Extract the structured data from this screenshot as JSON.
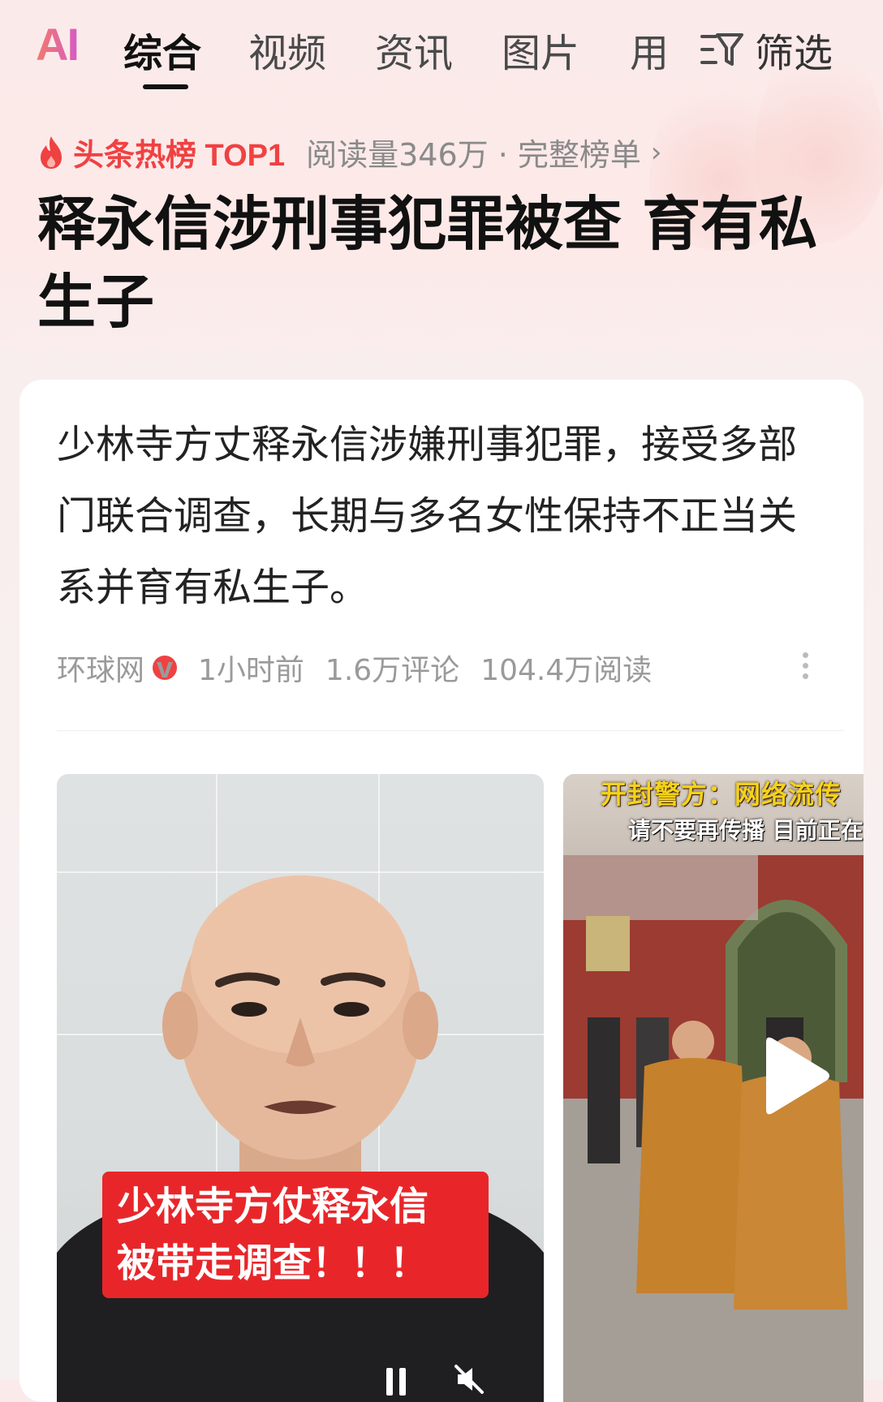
{
  "tabs": {
    "ai_logo": "AI",
    "items": [
      {
        "label": "综合",
        "active": true
      },
      {
        "label": "视频",
        "active": false
      },
      {
        "label": "资讯",
        "active": false
      },
      {
        "label": "图片",
        "active": false
      },
      {
        "label": "用",
        "active": false
      }
    ],
    "filter_label": "筛选"
  },
  "hot": {
    "label": "头条热榜 TOP1",
    "meta": "阅读量346万 · 完整榜单",
    "chevron": "›"
  },
  "headline": "释永信涉刑事犯罪被查 育有私生子",
  "card": {
    "summary": "少林寺方丈释永信涉嫌刑事犯罪，接受多部门联合调查，长期与多名女性保持不正当关系并育有私生子。",
    "source": "环球网",
    "verified_badge": "v",
    "time": "1小时前",
    "comments": "1.6万评论",
    "reads": "104.4万阅读"
  },
  "media": {
    "video1_caption_line1": "少林寺方仗释永信",
    "video1_caption_line2": "被带走调查！！！",
    "video2_caption_line1": "开封警方：网络流传",
    "video2_caption_line2": "请不要再传播 目前正在"
  },
  "colors": {
    "accent_red": "#f04142",
    "caption_red": "#e8262a",
    "caption_yellow": "#f4d21c"
  }
}
